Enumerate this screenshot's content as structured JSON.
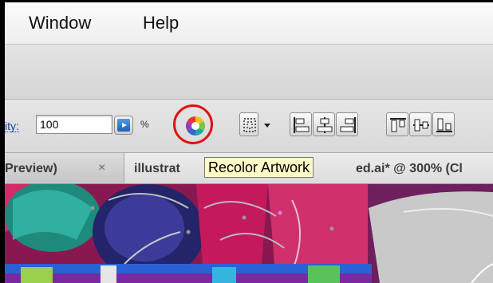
{
  "menubar": {
    "items": [
      {
        "label": "Window"
      },
      {
        "label": "Help"
      }
    ]
  },
  "controlbar": {
    "opacity_label": "ity:",
    "opacity_value": "100",
    "percent_symbol": "%",
    "recolor_icon": "color-wheel-icon",
    "buttons": [
      {
        "name": "selection-dropdown-button",
        "icon": "dotted-select-icon"
      },
      {
        "name": "align-left-button",
        "icon": "align-left-icon"
      },
      {
        "name": "align-center-button",
        "icon": "align-horizontal-center-icon"
      },
      {
        "name": "align-right-button",
        "icon": "align-right-icon"
      },
      {
        "name": "align-top-button",
        "icon": "align-top-icon"
      },
      {
        "name": "align-vertical-center-button",
        "icon": "align-vertical-center-icon"
      },
      {
        "name": "align-bottom-button",
        "icon": "align-bottom-icon"
      }
    ]
  },
  "tabs": [
    {
      "label": "Preview)",
      "close": "×"
    },
    {
      "label_left": "illustrat",
      "label_right": "ed.ai* @ 300% (Cl"
    }
  ],
  "tooltip": {
    "text": "Recolor Artwork"
  },
  "colors": {
    "highlight_ring": "#e01212",
    "tooltip_bg": "#fffcc6",
    "stepper_blue": "#2a74cf"
  }
}
